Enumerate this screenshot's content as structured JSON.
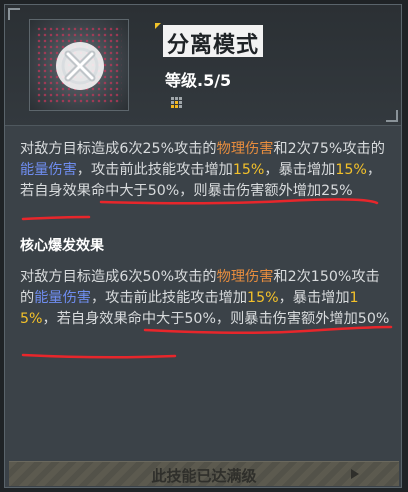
{
  "skill": {
    "title": "分离模式",
    "level": "等级.5/5"
  },
  "description": {
    "t1": "对敌方目标造成6次25%攻击的",
    "t2": "物理伤害",
    "t3": "和2次75%攻击的",
    "t4": "能量伤害",
    "t5": "，攻击前此技能攻击增加",
    "t6": "15%",
    "t7": "，暴击增加",
    "t8": "15%",
    "t9": "，若自身效果命中大于50%，则暴击伤害额外增加25%"
  },
  "core": {
    "title": "核心爆发效果",
    "t1": "对敌方目标造成6次50%攻击的",
    "t2": "物理伤害",
    "t3": "和2次150%攻击的",
    "t4": "能量伤害",
    "t5": "，攻击前此技能攻击增加",
    "t6": "15%",
    "t7": "，暴击增加",
    "t8": "15%",
    "t9": "，若自身效果命中大于50%，则暴击伤害额外增加50%"
  },
  "footer": {
    "label": "此技能已达满级"
  },
  "colors": {
    "physical": "#e68c3e",
    "energy": "#6f8df0",
    "percent": "#f3c12a",
    "annotation": "#e8262b"
  },
  "icons": [
    "skill-x-icon",
    "grid-icon",
    "arrow-right-icon"
  ]
}
